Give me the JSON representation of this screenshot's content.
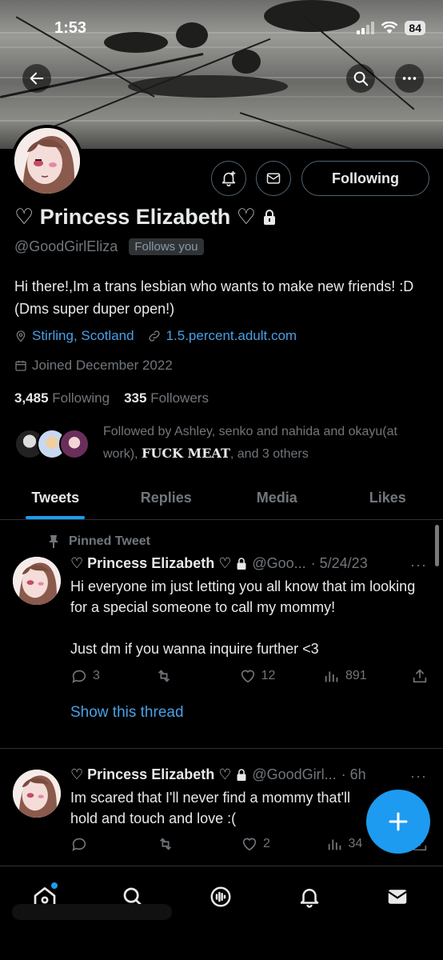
{
  "status": {
    "time": "1:53",
    "battery": "84"
  },
  "profile": {
    "name": "♡ Princess Elizabeth ♡",
    "handle": "@GoodGirlEliza",
    "follows_you": "Follows you",
    "bio": "Hi there!,Im a trans lesbian who wants to make new friends! :D (Dms super duper open!)",
    "location": "Stirling, Scotland",
    "website": "1.5.percent.adult.com",
    "joined": "Joined December 2022",
    "following_count": "3,485",
    "following_label": "Following",
    "followers_count": "335",
    "followers_label": "Followers",
    "followed_by": {
      "prefix": "Followed by ",
      "name1": "Ashley",
      "middle": ", senko and nahida and okayu(at work), ",
      "name2": "FUCK MEAT",
      "suffix": ", and 3 others"
    },
    "following_button": "Following"
  },
  "tabs": [
    {
      "label": "Tweets"
    },
    {
      "label": "Replies"
    },
    {
      "label": "Media"
    },
    {
      "label": "Likes"
    }
  ],
  "tweets": [
    {
      "pinned_label": "Pinned Tweet",
      "name": "♡ Princess Elizabeth ♡",
      "handle": "@Goo...",
      "time": "· 5/24/23",
      "text_line1": "Hi everyone im just letting you all know that im looking for a special someone to call my mommy!",
      "text_line2": "Just dm if you wanna inquire further <3",
      "replies": "3",
      "retweets": "",
      "likes": "12",
      "views": "891",
      "show_thread": "Show this thread"
    },
    {
      "name": "♡ Princess Elizabeth ♡",
      "handle": "@GoodGirl...",
      "time": "· 6h",
      "text": "Im scared that I'll never find a mommy that'll hold and touch and love :(",
      "replies": "",
      "retweets": "",
      "likes": "2",
      "views": "34"
    }
  ],
  "colors": {
    "accent": "#1d9bf0",
    "link": "#4b9fe6",
    "muted": "#71767b",
    "border": "#2f3336"
  }
}
